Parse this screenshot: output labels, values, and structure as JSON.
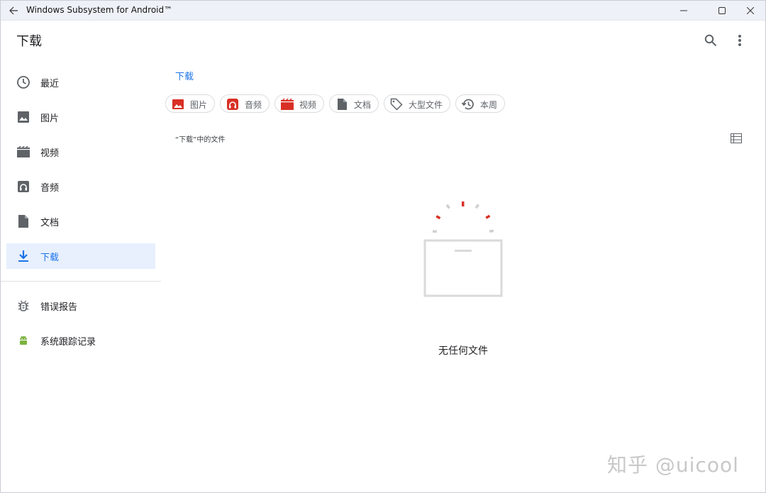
{
  "window": {
    "title": "Windows Subsystem for Android™"
  },
  "header": {
    "title": "下载"
  },
  "sidebar": {
    "items": [
      {
        "label": "最近",
        "icon": "clock-icon"
      },
      {
        "label": "图片",
        "icon": "image-icon"
      },
      {
        "label": "视频",
        "icon": "movie-icon"
      },
      {
        "label": "音频",
        "icon": "audio-icon"
      },
      {
        "label": "文档",
        "icon": "document-icon"
      },
      {
        "label": "下载",
        "icon": "download-icon",
        "active": true
      }
    ],
    "extra_items": [
      {
        "label": "错误报告",
        "icon": "bug-icon"
      },
      {
        "label": "系统跟踪记录",
        "icon": "android-icon"
      }
    ]
  },
  "breadcrumb": "下载",
  "chips": [
    {
      "label": "图片",
      "icon": "image-icon",
      "color": "#d93025"
    },
    {
      "label": "音频",
      "icon": "headphones-icon",
      "color": "#d93025"
    },
    {
      "label": "视频",
      "icon": "movie-icon",
      "color": "#d93025"
    },
    {
      "label": "文档",
      "icon": "document-icon",
      "color": "#5f6368"
    },
    {
      "label": "大型文件",
      "icon": "tag-icon",
      "color": "#5f6368"
    },
    {
      "label": "本周",
      "icon": "history-icon",
      "color": "#5f6368"
    }
  ],
  "section": {
    "label": "“下载”中的文件"
  },
  "empty_state": {
    "text": "无任何文件"
  },
  "watermark": "知乎 @uicool",
  "colors": {
    "accent": "#1a73e8",
    "active_bg": "#e8f0fe",
    "titlebar_bg": "#eef2f8",
    "red": "#d93025"
  }
}
